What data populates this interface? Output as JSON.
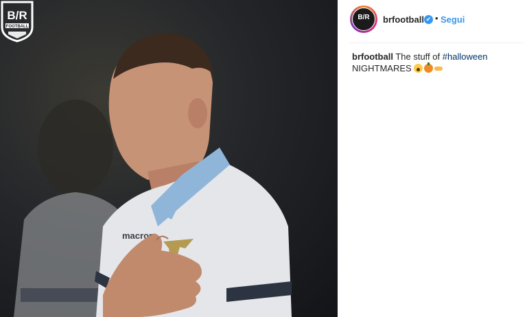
{
  "post": {
    "image_description_logo": "B/R FOOTBALL",
    "logo_text_top": "B/R",
    "logo_text_bottom": "FOOTBALL",
    "jersey_brand": "macron"
  },
  "header": {
    "avatar_text": "B/R",
    "username": "brfootball",
    "verified_mark": "✔",
    "separator": "•",
    "follow_label": "Segui"
  },
  "caption": {
    "username": "brfootball",
    "text": "The stuff of ",
    "hashtag": "#halloween",
    "text2": "NIGHTMARES",
    "emojis": [
      "scream-emoji",
      "pumpkin-emoji",
      "pointing-hand-emoji"
    ]
  },
  "colors": {
    "follow_blue": "#3897f0",
    "hashtag_blue": "#003569",
    "verified_blue": "#3897f0"
  }
}
